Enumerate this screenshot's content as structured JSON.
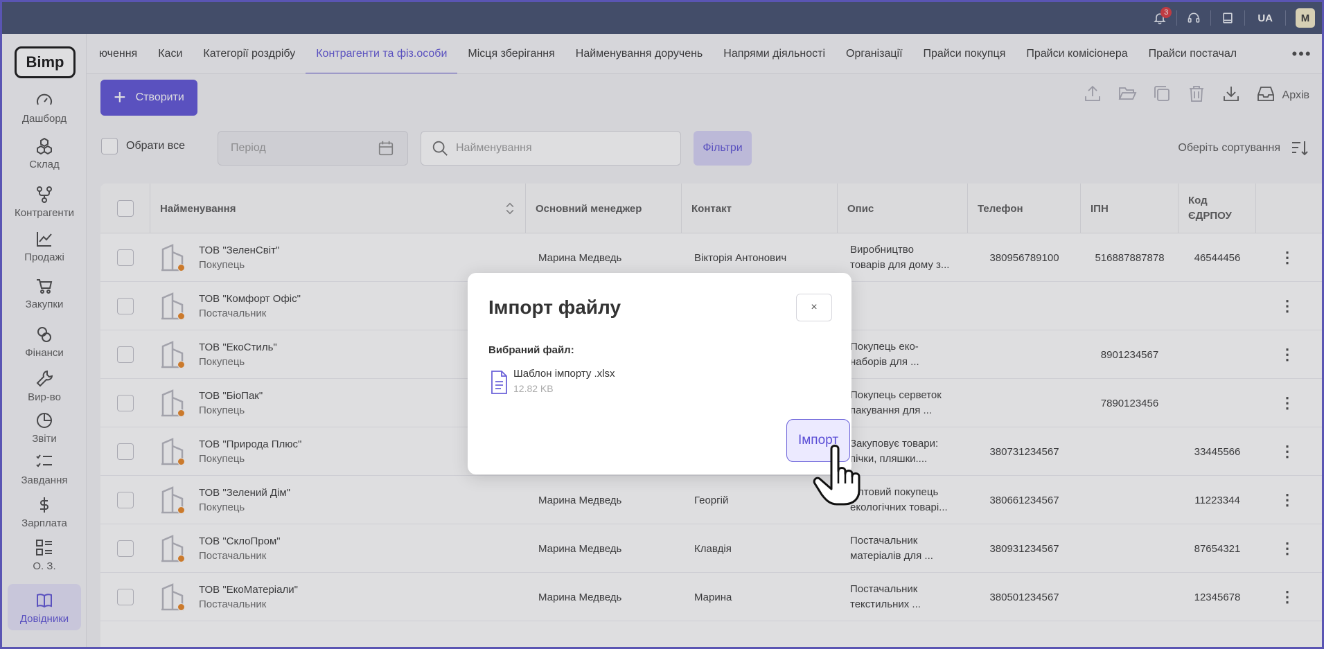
{
  "topbar": {
    "notification_count": "3",
    "language": "UA",
    "avatar_letter": "M",
    "icons": [
      "bell-icon",
      "headset-icon",
      "book-icon"
    ]
  },
  "logo": "Bimp",
  "sidebar": {
    "items": [
      {
        "label": "Дашборд",
        "icon": "gauge-icon"
      },
      {
        "label": "Склад",
        "icon": "boxes-icon"
      },
      {
        "label": "Контрагенти",
        "icon": "network-icon"
      },
      {
        "label": "Продажі",
        "icon": "chart-line-icon"
      },
      {
        "label": "Закупки",
        "icon": "cart-icon"
      },
      {
        "label": "Фінанси",
        "icon": "coins-icon"
      },
      {
        "label": "Вир-во",
        "icon": "wrench-icon"
      },
      {
        "label": "Звіти",
        "icon": "pie-chart-icon"
      },
      {
        "label": "Завдання",
        "icon": "tasks-icon"
      },
      {
        "label": "Зарплата",
        "icon": "dollar-icon"
      },
      {
        "label": "О. З.",
        "icon": "list-icon"
      },
      {
        "label": "Довідники",
        "icon": "open-book-icon",
        "active": true
      }
    ]
  },
  "tabs": [
    "ючення",
    "Каси",
    "Категорії роздрібу",
    "Контрагенти та фіз.особи",
    "Місця зберігання",
    "Найменування доручень",
    "Напрями діяльності",
    "Організації",
    "Прайси покупця",
    "Прайси комісіонера",
    "Прайси постачал"
  ],
  "active_tab": "Контрагенти та фіз.особи",
  "toolbar": {
    "create_label": "Створити",
    "archive_label": "Архів"
  },
  "filters": {
    "select_all": "Обрати все",
    "period_placeholder": "Період",
    "search_placeholder": "Найменування",
    "filters_label": "Фільтри",
    "sort_label": "Оберіть сортування"
  },
  "table": {
    "headers": [
      "Найменування",
      "Основний менеджер",
      "Контакт",
      "Опис",
      "Телефон",
      "ІПН",
      "Код ЄДРПОУ"
    ],
    "rows": [
      {
        "name": "ТОВ \"ЗеленСвіт\"",
        "type": "Покупець",
        "manager": "Марина Медведь",
        "contact": "Вікторія Антонович",
        "desc1": "Виробництво",
        "desc2": "товарів для дому з...",
        "phone": "380956789100",
        "ipn": "516887887878",
        "edrpou": "46544456"
      },
      {
        "name": "ТОВ \"Комфорт Офіс\"",
        "type": "Постачальник",
        "manager": "",
        "contact": "",
        "desc1": "",
        "desc2": "",
        "phone": "",
        "ipn": "",
        "edrpou": ""
      },
      {
        "name": "ТОВ \"ЕкоСтиль\"",
        "type": "Покупець",
        "manager": "",
        "contact": "",
        "desc1": "Покупець еко-",
        "desc2": "наборів для ...",
        "phone": "",
        "ipn": "8901234567",
        "edrpou": ""
      },
      {
        "name": "ТОВ \"БіоПак\"",
        "type": "Покупець",
        "manager": "",
        "contact": "",
        "desc1": "Покупець серветок",
        "desc2": "пакування для ...",
        "phone": "",
        "ipn": "7890123456",
        "edrpou": ""
      },
      {
        "name": "ТОВ \"Природа Плюс\"",
        "type": "Покупець",
        "manager": "",
        "contact": "",
        "desc1": "Закуповує товари:",
        "desc2": "пічки, пляшки....",
        "phone": "380731234567",
        "ipn": "",
        "edrpou": "33445566"
      },
      {
        "name": "ТОВ \"Зелений Дім\"",
        "type": "Покупець",
        "manager": "Марина Медведь",
        "contact": "Георгій",
        "desc1": "Оптовий покупець",
        "desc2": "екологічних товарі...",
        "phone": "380661234567",
        "ipn": "",
        "edrpou": "11223344"
      },
      {
        "name": "ТОВ \"СклоПром\"",
        "type": "Постачальник",
        "manager": "Марина Медведь",
        "contact": "Клавдія",
        "desc1": "Постачальник",
        "desc2": "матеріалів для ...",
        "phone": "380931234567",
        "ipn": "",
        "edrpou": "87654321"
      },
      {
        "name": "ТОВ \"ЕкоМатеріали\"",
        "type": "Постачальник",
        "manager": "Марина Медведь",
        "contact": "Марина",
        "desc1": " Постачальник",
        "desc2": "текстильних ...",
        "phone": "380501234567",
        "ipn": "",
        "edrpou": "12345678"
      }
    ]
  },
  "modal": {
    "title": "Імпорт файлу",
    "close": "×",
    "chosen_label": "Вибраний файл:",
    "file_name": "Шаблон імпорту .xlsx",
    "file_size": "12.82 KB",
    "import_label": "Імпорт"
  },
  "colors": {
    "accent": "#5b4fd6",
    "topbar": "#3e4a6b",
    "status_dot": "#e8821e"
  }
}
